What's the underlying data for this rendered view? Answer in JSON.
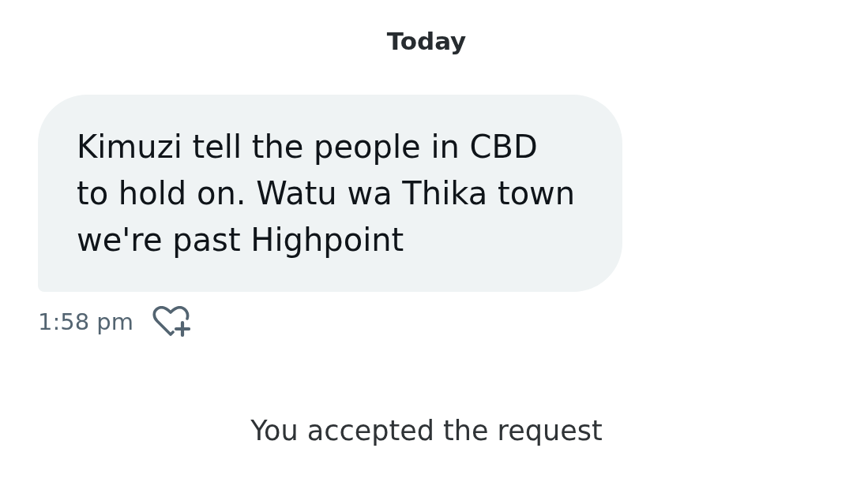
{
  "date_divider": "Today",
  "messages": [
    {
      "text": "Kimuzi tell the people in CBD\nto hold on. Watu wa Thika town we're past Highpoint",
      "time": "1:58 pm"
    }
  ],
  "system_notice": "You accepted the request"
}
